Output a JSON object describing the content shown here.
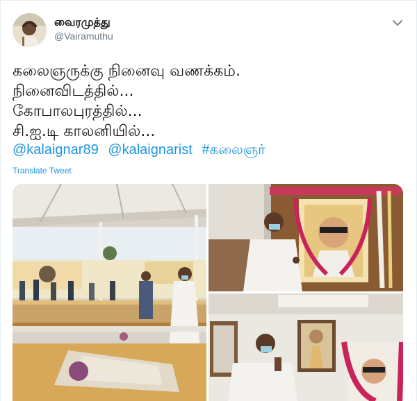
{
  "user": {
    "display_name": "வைரமுத்து",
    "handle": "@Vairamuthu"
  },
  "tweet": {
    "lines": [
      "கலைஞருக்கு நினைவு வணக்கம்.",
      "நினைவிடத்தில்...",
      "கோபாலபுரத்தில்...",
      "சி.ஐ.டி காலனியில்..."
    ],
    "links": [
      "@kalaignar89",
      "@kalaignarist",
      "#கலைஞர்"
    ],
    "translate_label": "Translate Tweet"
  },
  "icons": {
    "menu": "chevron-down-icon"
  },
  "colors": {
    "link": "#1b95e0",
    "secondary_text": "#657786",
    "border": "#e6ecf0"
  },
  "media": {
    "photos": [
      "memorial-tribute-photo",
      "portrait-garland-photo",
      "home-portrait-photo"
    ]
  }
}
